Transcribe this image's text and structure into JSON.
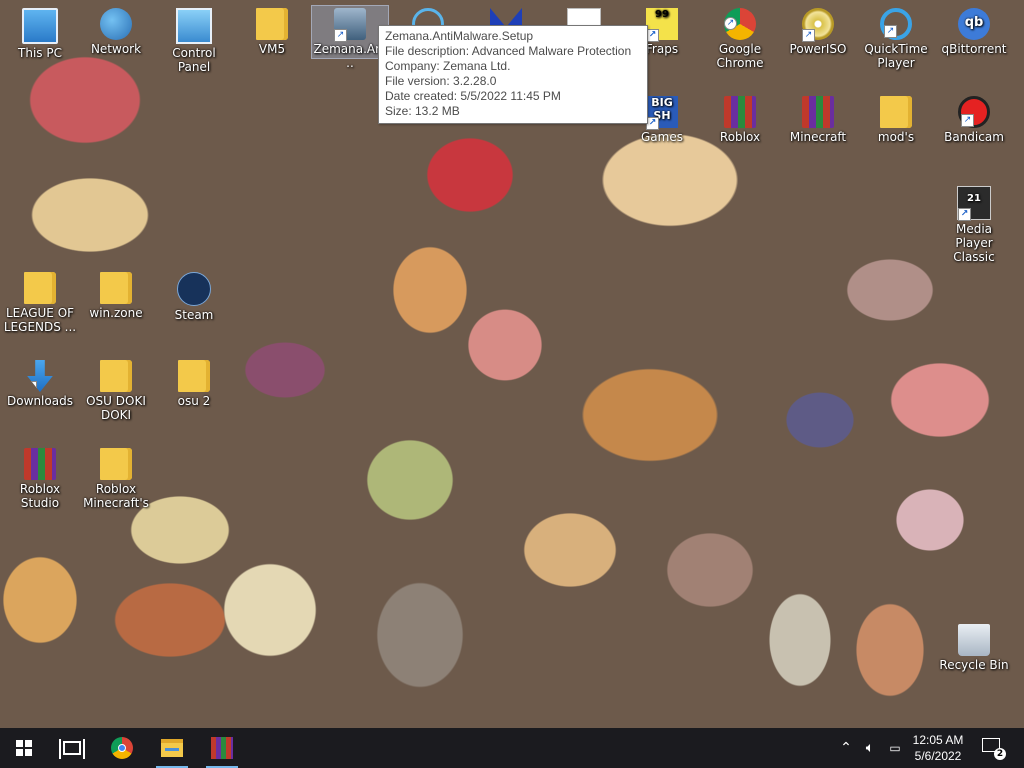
{
  "desktop": {
    "icons": [
      {
        "label": "This PC"
      },
      {
        "label": "Network"
      },
      {
        "label": "Control Panel"
      },
      {
        "label": "VM5"
      },
      {
        "label": "Zemana.An..."
      },
      {
        "label": "Fraps"
      },
      {
        "label": "Google Chrome"
      },
      {
        "label": "PowerISO"
      },
      {
        "label": "QuickTime Player"
      },
      {
        "label": "qBittorrent"
      },
      {
        "label": "Games"
      },
      {
        "label": "Roblox"
      },
      {
        "label": "Minecraft"
      },
      {
        "label": "mod's"
      },
      {
        "label": "Bandicam"
      },
      {
        "label": "Media Player Classic"
      },
      {
        "label": "LEAGUE OF LEGENDS ..."
      },
      {
        "label": "win.zone"
      },
      {
        "label": "Steam"
      },
      {
        "label": "Downloads"
      },
      {
        "label": "OSU DOKI DOKI"
      },
      {
        "label": "osu 2"
      },
      {
        "label": "Roblox Studio"
      },
      {
        "label": "Roblox Minecraft's"
      },
      {
        "label": "Recycle Bin"
      }
    ],
    "glyph_text": {
      "fraps": "99",
      "bighsh": "BIG SH",
      "mpc": "21",
      "qbittorrent": "qb"
    }
  },
  "tooltip": {
    "lines": [
      "Zemana.AntiMalware.Setup",
      "File description: Advanced Malware Protection",
      "Company: Zemana Ltd.",
      "File version: 3.2.28.0",
      "Date created: 5/5/2022 11:45 PM",
      "Size: 13.2 MB"
    ]
  },
  "taskbar": {
    "tray_icons": [
      "chevron-up-icon",
      "speaker-icon",
      "network-icon"
    ],
    "clock": {
      "time": "12:05 AM",
      "date": "5/6/2022"
    },
    "notification_count": "2"
  }
}
